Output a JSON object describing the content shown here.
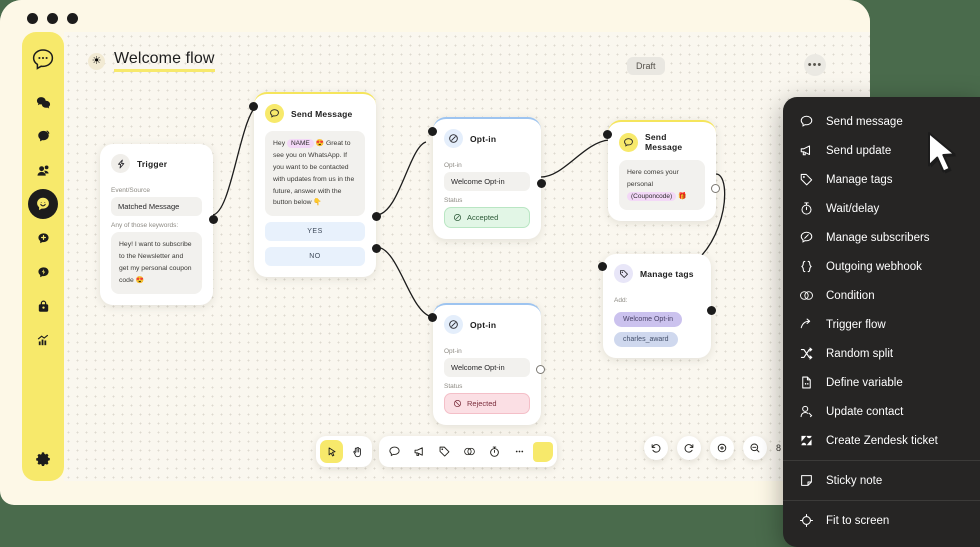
{
  "window": {
    "traffic_lights": 3
  },
  "sidebar": {
    "logo_icon": "chat-bubble-logo",
    "items": [
      {
        "icon": "chats-icon",
        "name": "chats",
        "active": false
      },
      {
        "icon": "broadcast-icon",
        "name": "broadcast",
        "active": false
      },
      {
        "icon": "contacts-icon",
        "name": "contacts",
        "active": false
      },
      {
        "icon": "flows-icon",
        "name": "flows",
        "active": true
      },
      {
        "icon": "add-chat-icon",
        "name": "add-chat",
        "active": false
      },
      {
        "icon": "automation-icon",
        "name": "automation",
        "active": false
      },
      {
        "icon": "commerce-icon",
        "name": "commerce",
        "active": false
      },
      {
        "icon": "analytics-icon",
        "name": "analytics",
        "active": false
      }
    ],
    "settings_icon": "gear-icon"
  },
  "canvas": {
    "flow_emoji": "☀",
    "flow_title": "Welcome flow",
    "status_badge": "Draft",
    "more_label": "•••"
  },
  "nodes": {
    "trigger": {
      "title": "Trigger",
      "icon": "trigger-bolt-icon",
      "field_label": "Event/Source",
      "field_value": "Matched Message",
      "keywords_label": "Any of those keywords:",
      "keywords_value": "Hey! I want to subscribe to the Newsletter and get my personal coupon code 😍"
    },
    "send_message_1": {
      "title": "Send Message",
      "icon": "message-icon",
      "text_pre": "Hey",
      "variable": "NAME",
      "text_post": "😍 Great to see you on WhatsApp. If you want to be contacted with updates from us in the future, answer with the button below 👇",
      "button_yes": "YES",
      "button_no": "NO"
    },
    "optin_accepted": {
      "title": "Opt-in",
      "icon": "optin-icon",
      "field_label": "Opt-in",
      "field_value": "Welcome Opt-in",
      "status_label": "Status",
      "status_value": "Accepted"
    },
    "optin_rejected": {
      "title": "Opt-in",
      "icon": "optin-icon",
      "field_label": "Opt-in",
      "field_value": "Welcome Opt-in",
      "status_label": "Status",
      "status_value": "Rejected"
    },
    "send_message_2": {
      "title": "Send Message",
      "icon": "message-icon",
      "text_pre": "Here comes your personal",
      "variable": "(Couponcode)",
      "text_post": "🎁"
    },
    "manage_tags": {
      "title": "Manage tags",
      "icon": "tag-icon",
      "add_label": "Add:",
      "tags": [
        "Welcome Opt-in",
        "charles_award"
      ]
    }
  },
  "toolbar": {
    "group_a": [
      {
        "icon": "cursor-select-icon",
        "name": "select-tool",
        "selected": true
      },
      {
        "icon": "hand-pan-icon",
        "name": "pan-tool",
        "selected": false
      }
    ],
    "group_b": [
      {
        "icon": "message-icon",
        "name": "add-send-message"
      },
      {
        "icon": "megaphone-icon",
        "name": "add-send-update"
      },
      {
        "icon": "tag-icon",
        "name": "add-manage-tags"
      },
      {
        "icon": "condition-icon",
        "name": "add-condition"
      },
      {
        "icon": "timer-icon",
        "name": "add-wait-delay"
      },
      {
        "icon": "ellipsis-icon",
        "name": "more-nodes"
      }
    ],
    "sticky_swatch": "sticky-note-swatch",
    "zoom_controls": [
      {
        "icon": "undo-icon",
        "name": "undo"
      },
      {
        "icon": "redo-icon",
        "name": "redo"
      },
      {
        "icon": "zoom-in-icon",
        "name": "zoom-in"
      },
      {
        "icon": "zoom-out-icon",
        "name": "zoom-out"
      }
    ],
    "zoom_percent": "8"
  },
  "context_menu": {
    "items": [
      {
        "label": "Send message",
        "icon": "message-icon"
      },
      {
        "label": "Send update",
        "icon": "megaphone-icon"
      },
      {
        "label": "Manage tags",
        "icon": "tag-icon"
      },
      {
        "label": "Wait/delay",
        "icon": "timer-icon"
      },
      {
        "label": "Manage subscribers",
        "icon": "subscribers-icon"
      },
      {
        "label": "Outgoing webhook",
        "icon": "braces-icon"
      },
      {
        "label": "Condition",
        "icon": "condition-icon"
      },
      {
        "label": "Trigger flow",
        "icon": "arrow-branch-icon"
      },
      {
        "label": "Random split",
        "icon": "shuffle-icon"
      },
      {
        "label": "Define variable",
        "icon": "variable-doc-icon"
      },
      {
        "label": "Update contact",
        "icon": "person-edit-icon"
      },
      {
        "label": "Create Zendesk ticket",
        "icon": "zendesk-icon"
      },
      {
        "label": "Sticky note",
        "icon": "sticky-note-icon"
      },
      {
        "label": "Fit to screen",
        "icon": "fit-screen-icon"
      }
    ],
    "separator_after": [
      11,
      12
    ]
  },
  "colors": {
    "brand_yellow": "#f7e96b",
    "page_bg": "#4a6b4c",
    "window_bg": "#fdf8e7",
    "canvas_bg": "#faf7ef",
    "menu_bg": "#262524",
    "accepted_green": "#e2f6e6",
    "rejected_pink": "#fbdfe4"
  }
}
